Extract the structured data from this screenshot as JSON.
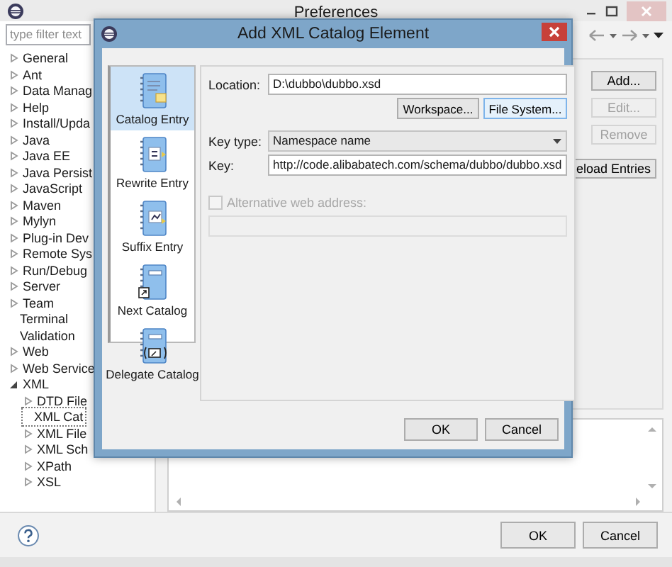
{
  "preferences": {
    "title": "Preferences",
    "filter": {
      "placeholder": "type filter text"
    },
    "tree": [
      {
        "label": "General",
        "expandable": true,
        "expanded": false,
        "selected": false
      },
      {
        "label": "Ant",
        "expandable": true,
        "expanded": false,
        "selected": false
      },
      {
        "label": "Data Manag",
        "expandable": true,
        "expanded": false,
        "selected": false
      },
      {
        "label": "Help",
        "expandable": true,
        "expanded": false,
        "selected": false
      },
      {
        "label": "Install/Upda",
        "expandable": true,
        "expanded": false,
        "selected": false
      },
      {
        "label": "Java",
        "expandable": true,
        "expanded": false,
        "selected": false
      },
      {
        "label": "Java EE",
        "expandable": true,
        "expanded": false,
        "selected": false
      },
      {
        "label": "Java Persist",
        "expandable": true,
        "expanded": false,
        "selected": false
      },
      {
        "label": "JavaScript",
        "expandable": true,
        "expanded": false,
        "selected": false
      },
      {
        "label": "Maven",
        "expandable": true,
        "expanded": false,
        "selected": false
      },
      {
        "label": "Mylyn",
        "expandable": true,
        "expanded": false,
        "selected": false
      },
      {
        "label": "Plug-in Dev",
        "expandable": true,
        "expanded": false,
        "selected": false
      },
      {
        "label": "Remote Sys",
        "expandable": true,
        "expanded": false,
        "selected": false
      },
      {
        "label": "Run/Debug",
        "expandable": true,
        "expanded": false,
        "selected": false
      },
      {
        "label": "Server",
        "expandable": true,
        "expanded": false,
        "selected": false
      },
      {
        "label": "Team",
        "expandable": true,
        "expanded": false,
        "selected": false
      },
      {
        "label": "Terminal",
        "expandable": false,
        "selected": false
      },
      {
        "label": "Validation",
        "expandable": false,
        "selected": false
      },
      {
        "label": "Web",
        "expandable": true,
        "expanded": false,
        "selected": false
      },
      {
        "label": "Web Service",
        "expandable": true,
        "expanded": false,
        "selected": false
      },
      {
        "label": "XML",
        "expandable": true,
        "expanded": true,
        "selected": false,
        "children": [
          {
            "label": "DTD File",
            "expandable": true,
            "expanded": false,
            "selected": false
          },
          {
            "label": "XML Cat",
            "expandable": false,
            "selected": true
          },
          {
            "label": "XML File",
            "expandable": true,
            "expanded": false,
            "selected": false
          },
          {
            "label": "XML Sch",
            "expandable": true,
            "expanded": false,
            "selected": false
          },
          {
            "label": "XPath",
            "expandable": true,
            "expanded": false,
            "selected": false
          },
          {
            "label": "XSL",
            "expandable": true,
            "expanded": false,
            "selected": false
          }
        ]
      }
    ],
    "side_buttons": [
      {
        "label": "Add...",
        "disabled": false
      },
      {
        "label": "Edit...",
        "disabled": true
      },
      {
        "label": "Remove",
        "disabled": true
      },
      {
        "label": "eload Entries",
        "disabled": false
      }
    ],
    "buttons": [
      "OK",
      "Cancel"
    ]
  },
  "dialog": {
    "title": "Add XML Catalog Element",
    "entry_types": [
      {
        "label": "Catalog Entry",
        "selected": true
      },
      {
        "label": "Rewrite Entry",
        "selected": false
      },
      {
        "label": "Suffix Entry",
        "selected": false
      },
      {
        "label": "Next Catalog",
        "selected": false
      },
      {
        "label": "Delegate Catalog",
        "selected": false
      }
    ],
    "location": {
      "label": "Location:",
      "value": "D:\\dubbo\\dubbo.xsd"
    },
    "location_buttons": [
      "Workspace...",
      "File System..."
    ],
    "key_type": {
      "label": "Key type:",
      "value": "Namespace name"
    },
    "key": {
      "label": "Key:",
      "value": "http://code.alibabatech.com/schema/dubbo/dubbo.xsd"
    },
    "alternative": {
      "label": "Alternative web address:",
      "checked": false,
      "disabled": true
    },
    "buttons": [
      "OK",
      "Cancel"
    ]
  }
}
